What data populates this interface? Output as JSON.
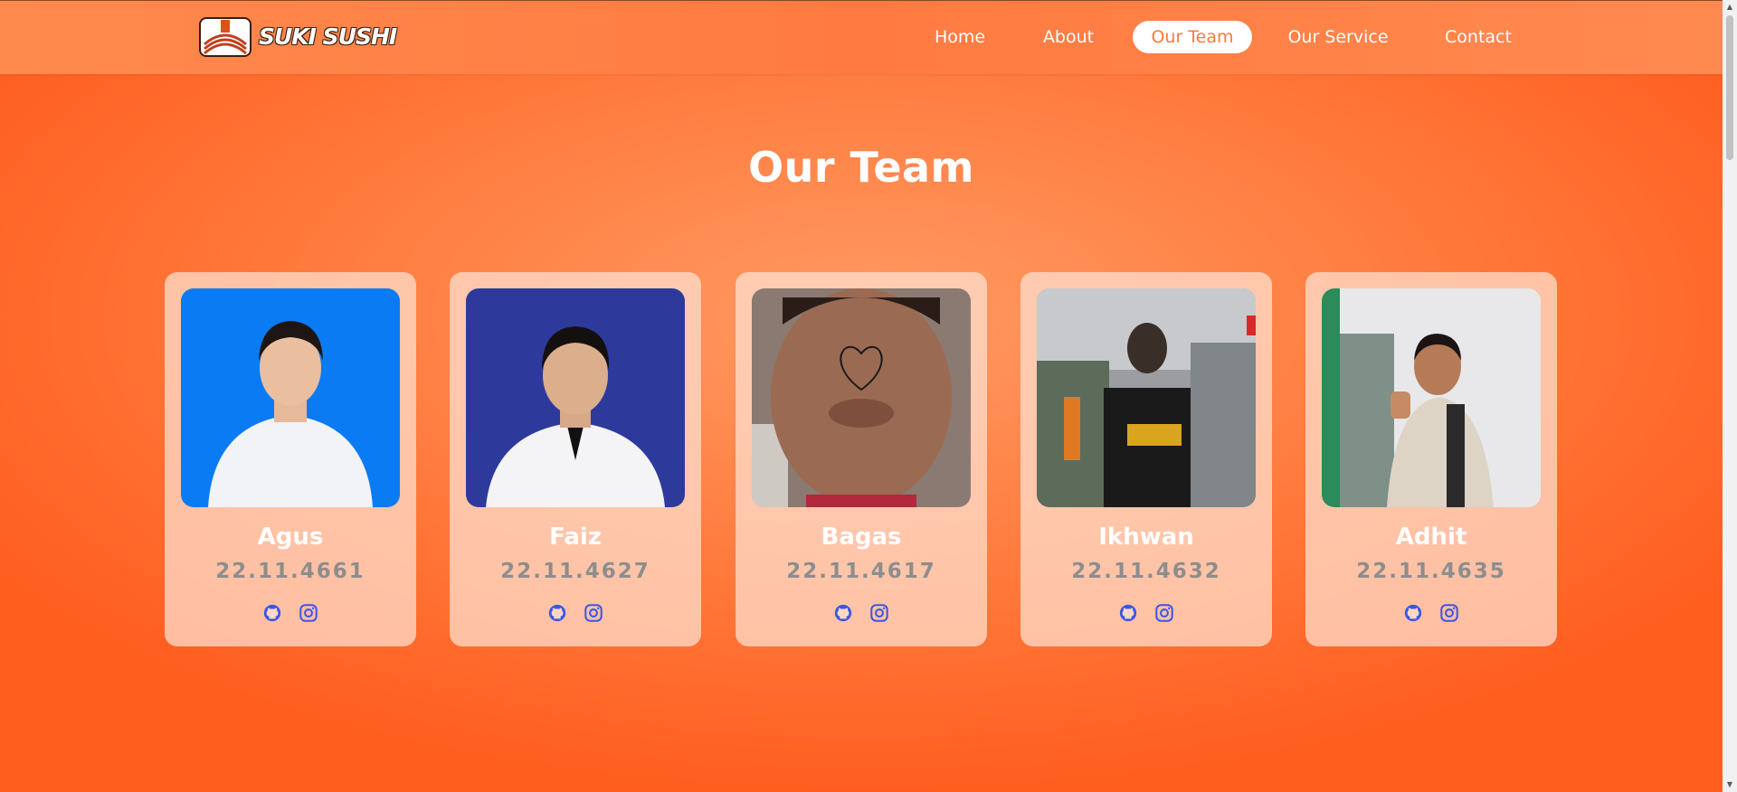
{
  "brand": {
    "name": "SUKI SUSHI"
  },
  "nav": {
    "items": [
      {
        "label": "Home",
        "active": false
      },
      {
        "label": "About",
        "active": false
      },
      {
        "label": "Our Team",
        "active": true
      },
      {
        "label": "Our Service",
        "active": false
      },
      {
        "label": "Contact",
        "active": false
      }
    ]
  },
  "section": {
    "title": "Our Team"
  },
  "team": [
    {
      "name": "Agus",
      "nim": "22.11.4661",
      "photo_bg": "#0a7bf2"
    },
    {
      "name": "Faiz",
      "nim": "22.11.4627",
      "photo_bg": "#2d3a9c"
    },
    {
      "name": "Bagas",
      "nim": "22.11.4617",
      "photo_bg": "#8a7a72"
    },
    {
      "name": "Ikhwan",
      "nim": "22.11.4632",
      "photo_bg": "#8c8c8c"
    },
    {
      "name": "Adhit",
      "nim": "22.11.4635",
      "photo_bg": "#e8e8ea"
    }
  ],
  "icons": {
    "github": "github-icon",
    "instagram": "instagram-icon"
  },
  "colors": {
    "accent": "#ff7a3c",
    "icon": "#3b55e6",
    "nim_text": "#8d8d8d"
  }
}
